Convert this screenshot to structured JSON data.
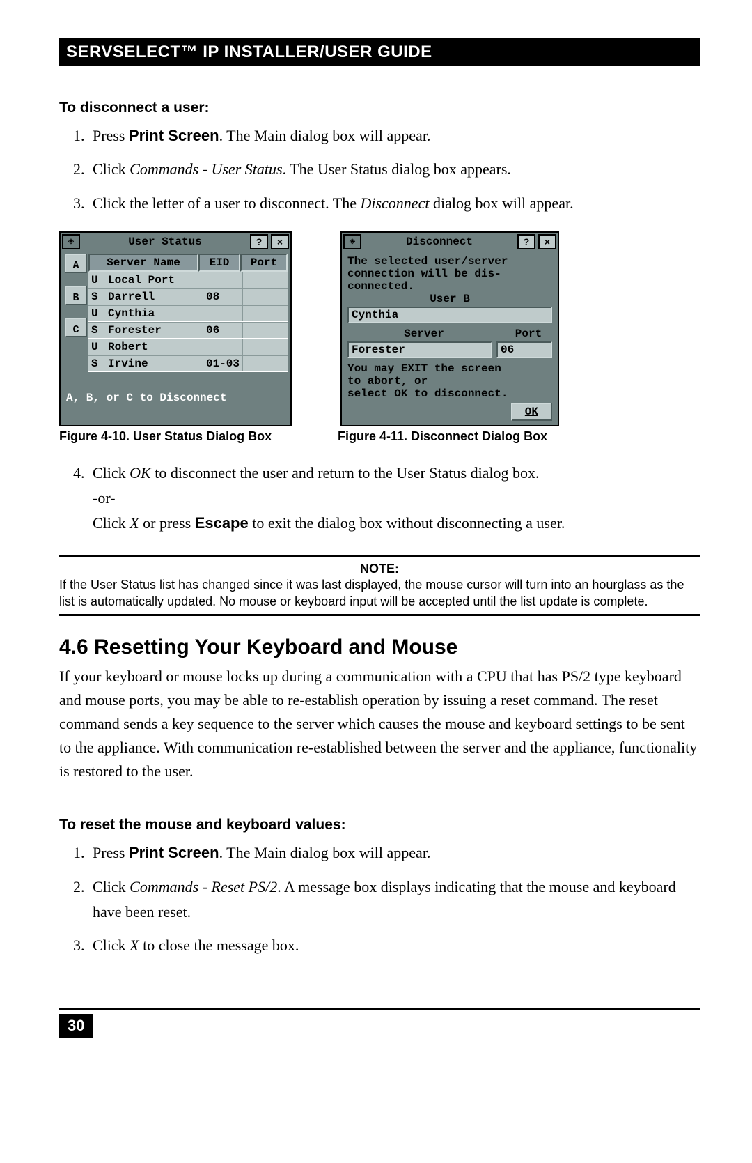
{
  "header": "SERVSELECT™ IP INSTALLER/USER GUIDE",
  "sec1_title": "To disconnect a user:",
  "steps1": {
    "s1a": "Press ",
    "s1b": "Print Screen",
    "s1c": ". The Main dialog box will appear.",
    "s2a": "Click ",
    "s2b": "Commands - User Status",
    "s2c": ". The User Status dialog box appears.",
    "s3a": "Click the letter of a user to disconnect. The ",
    "s3b": "Disconnect",
    "s3c": " dialog box will appear."
  },
  "user_status": {
    "title": "User Status",
    "help": "?",
    "close": "×",
    "cols": {
      "c1": "Server Name",
      "c2": "EID",
      "c3": "Port"
    },
    "letters": [
      "A",
      "B",
      "C"
    ],
    "rows": [
      {
        "t": "U",
        "name": "Local Port",
        "eid": "",
        "port": ""
      },
      {
        "t": "S",
        "name": "Darrell",
        "eid": "08",
        "port": ""
      },
      {
        "t": "U",
        "name": "Cynthia",
        "eid": "",
        "port": ""
      },
      {
        "t": "S",
        "name": "Forester",
        "eid": "06",
        "port": ""
      },
      {
        "t": "U",
        "name": "Robert",
        "eid": "",
        "port": ""
      },
      {
        "t": "S",
        "name": "Irvine",
        "eid": "01-03",
        "port": ""
      }
    ],
    "foot": "A, B, or C to Disconnect"
  },
  "disconnect": {
    "title": "Disconnect",
    "help": "?",
    "close": "×",
    "msg1": "The selected user/server",
    "msg2": "connection will be dis-",
    "msg3": "connected.",
    "userlabel": "User B",
    "user": "Cynthia",
    "col_server": "Server",
    "col_port": "Port",
    "server": "Forester",
    "port": "06",
    "msg4": "You may EXIT the screen",
    "msg5": "to abort, or",
    "msg6": "select OK to disconnect.",
    "ok": "OK"
  },
  "captions": {
    "c1": "Figure 4-10. User Status Dialog Box",
    "c2": "Figure 4-11. Disconnect Dialog Box"
  },
  "steps2": {
    "s4a": "Click ",
    "s4b": "OK",
    "s4c": " to disconnect the user and return to the User Status dialog box.",
    "or": "-or-",
    "s4d": "Click ",
    "s4e": "X",
    "s4f": " or press ",
    "s4g": "Escape",
    "s4h": " to exit the dialog box without disconnecting a user."
  },
  "note": {
    "label": "NOTE:",
    "text": "If the User Status list has changed since it was last displayed, the mouse cursor will turn into an hourglass as the list is automatically updated. No mouse or keyboard input will be accepted until the list update is complete."
  },
  "sec2_h": "4.6 Resetting Your Keyboard and Mouse",
  "sec2_p": "If your keyboard or mouse locks up during a communication with a CPU that has PS/2 type keyboard and mouse ports, you may be able to re-establish operation by issuing a reset command. The reset command sends a key sequence to the server which causes the mouse and keyboard settings to be sent to the appliance. With communication re-established between the server and the appliance, functionality is restored to the user.",
  "sec3_title": "To reset the mouse and keyboard values:",
  "steps3": {
    "s1a": "Press ",
    "s1b": "Print Screen",
    "s1c": ". The Main dialog box will appear.",
    "s2a": "Click ",
    "s2b": "Commands - Reset PS/2",
    "s2c": ". A message box displays indicating that the mouse and keyboard have been reset.",
    "s3a": "Click ",
    "s3b": "X",
    "s3c": " to close the message box."
  },
  "page_num": "30"
}
